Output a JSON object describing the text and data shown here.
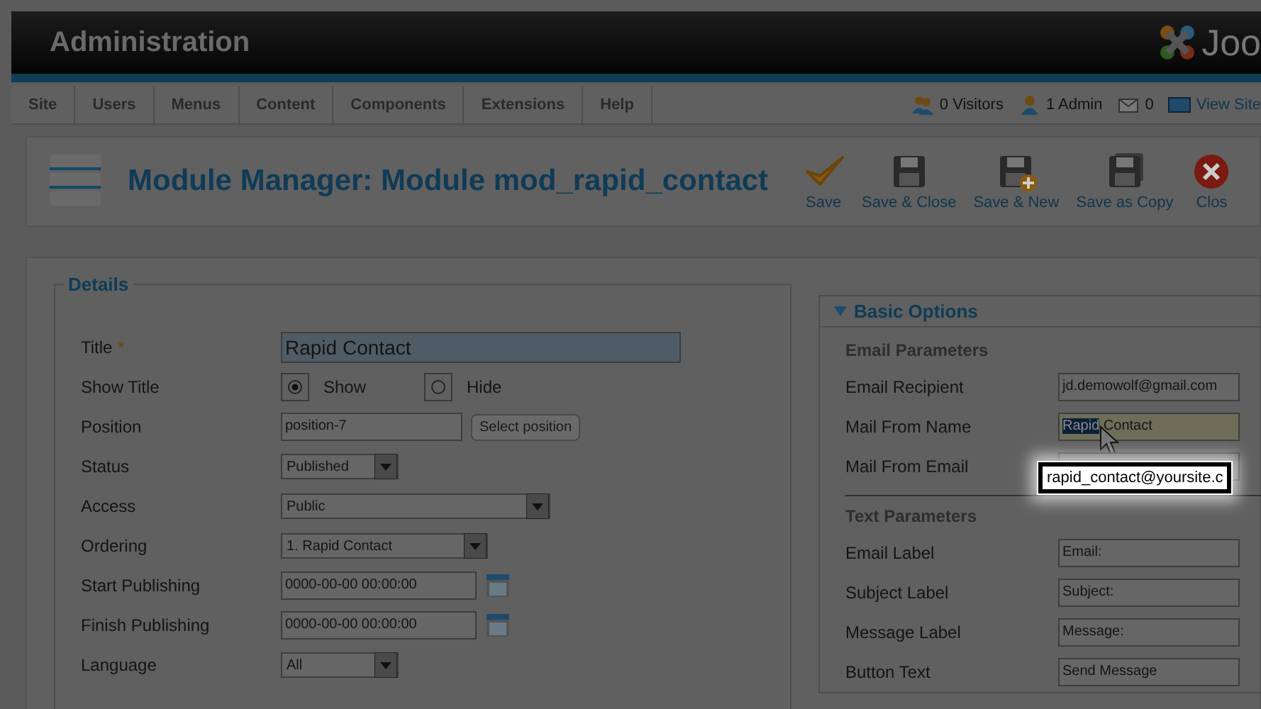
{
  "header": {
    "title": "Administration",
    "logo_text": "Joo"
  },
  "menu": {
    "items": [
      {
        "label": "Site"
      },
      {
        "label": "Users"
      },
      {
        "label": "Menus"
      },
      {
        "label": "Content"
      },
      {
        "label": "Components"
      },
      {
        "label": "Extensions"
      },
      {
        "label": "Help"
      }
    ],
    "status": [
      {
        "kind": "visitors",
        "label": "0 Visitors"
      },
      {
        "kind": "admins",
        "label": "1 Admin"
      },
      {
        "kind": "messages",
        "label": "0"
      },
      {
        "kind": "site",
        "label": "View Site"
      }
    ]
  },
  "toolbar": {
    "title": "Module Manager: Module mod_rapid_contact",
    "buttons": [
      {
        "kind": "save",
        "label": "Save"
      },
      {
        "kind": "save-close",
        "label": "Save & Close"
      },
      {
        "kind": "save-new",
        "label": "Save & New"
      },
      {
        "kind": "save-copy",
        "label": "Save as Copy"
      },
      {
        "kind": "close",
        "label": "Clos"
      }
    ]
  },
  "details": {
    "legend": "Details",
    "fields": [
      {
        "kind": "text",
        "label": "Title",
        "required_mark": "*",
        "value": "Rapid Contact",
        "focused": true
      },
      {
        "kind": "radio",
        "label": "Show Title",
        "options": [
          {
            "label": "Show",
            "selected": true
          },
          {
            "label": "Hide",
            "selected": false
          }
        ]
      },
      {
        "kind": "position",
        "label": "Position",
        "value": "position-7",
        "button": "Select position"
      },
      {
        "kind": "select",
        "label": "Status",
        "value": "Published"
      },
      {
        "kind": "select",
        "label": "Access",
        "value": "Public"
      },
      {
        "kind": "select",
        "label": "Ordering",
        "value": "1. Rapid Contact"
      },
      {
        "kind": "date",
        "label": "Start Publishing",
        "value": "0000-00-00 00:00:00"
      },
      {
        "kind": "date",
        "label": "Finish Publishing",
        "value": "0000-00-00 00:00:00"
      },
      {
        "kind": "select",
        "label": "Language",
        "value": "All"
      }
    ]
  },
  "options": {
    "heading": "Basic Options",
    "expanded": true,
    "groups": [
      {
        "title": "Email Parameters",
        "fields": [
          {
            "label": "Email Recipient",
            "value_parts": [
              {
                "text": "jd.demowolf@gmail.com",
                "selected": false
              }
            ]
          },
          {
            "label": "Mail From Name",
            "active": true,
            "value_parts": [
              {
                "text": "Rapid",
                "selected": true
              },
              {
                "text": " Contact",
                "selected": false
              }
            ]
          },
          {
            "label": "Mail From Email",
            "callout": "rapid_contact@yoursite.c"
          }
        ]
      },
      {
        "title": "Text Parameters",
        "fields": [
          {
            "label": "Email Label",
            "value_parts": [
              {
                "text": "Email:",
                "selected": false
              }
            ]
          },
          {
            "label": "Subject Label",
            "value_parts": [
              {
                "text": "Subject:",
                "selected": false
              }
            ]
          },
          {
            "label": "Message Label",
            "value_parts": [
              {
                "text": "Message:",
                "selected": false
              }
            ]
          },
          {
            "label": "Button Text",
            "value_parts": [
              {
                "text": "Send Message",
                "selected": false
              }
            ]
          }
        ]
      }
    ]
  }
}
